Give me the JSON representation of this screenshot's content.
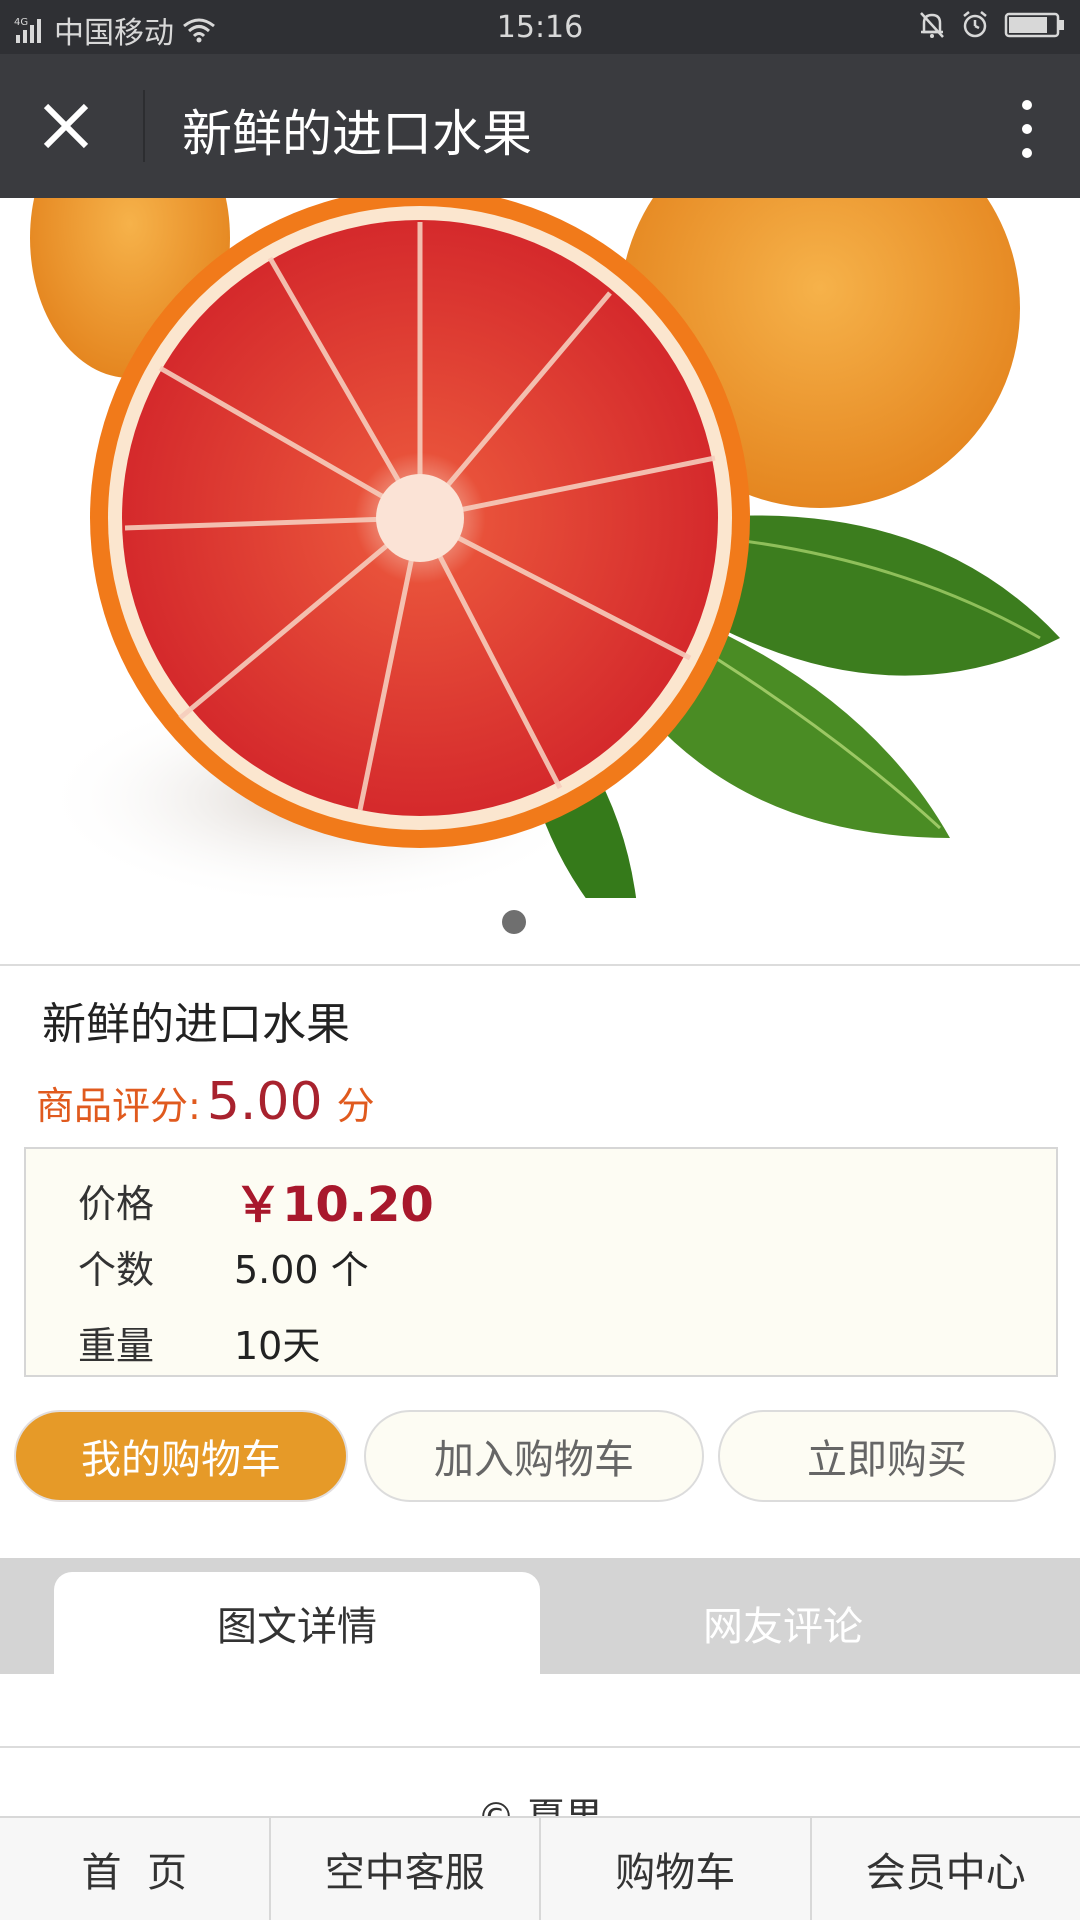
{
  "status_bar": {
    "network": "4G",
    "carrier": "中国移动",
    "time": "15:16"
  },
  "title_bar": {
    "title": "新鲜的进口水果"
  },
  "product": {
    "name": "新鲜的进口水果",
    "rating_label": "商品评分:",
    "rating_value": "5.00",
    "rating_unit": "分",
    "specs": [
      {
        "label": "价格",
        "value": "￥10.20"
      },
      {
        "label": "个数",
        "value": "5.00 个"
      },
      {
        "label": "重量",
        "value": "10天"
      }
    ]
  },
  "actions": {
    "my_cart": "我的购物车",
    "add_to_cart": "加入购物车",
    "buy_now": "立即购买"
  },
  "tabs": [
    {
      "label": "图文详情",
      "active": true
    },
    {
      "label": "网友评论",
      "active": false
    }
  ],
  "footer": {
    "copyright": "© 夏果"
  },
  "bottom_nav": [
    {
      "label": "首  页"
    },
    {
      "label": "空中客服"
    },
    {
      "label": "购物车"
    },
    {
      "label": "会员中心"
    }
  ],
  "colors": {
    "status_bar_bg": "#2f3034",
    "title_bar_bg": "#3a3b3f",
    "accent_orange": "#e69a28",
    "price_red": "#a8182c",
    "rating_orange": "#e05a1e"
  },
  "icons": {
    "close": "close-icon",
    "more": "more-vertical-icon",
    "signal": "signal-icon",
    "wifi": "wifi-icon",
    "bell_off": "bell-off-icon",
    "alarm": "alarm-clock-icon",
    "battery": "battery-icon"
  }
}
